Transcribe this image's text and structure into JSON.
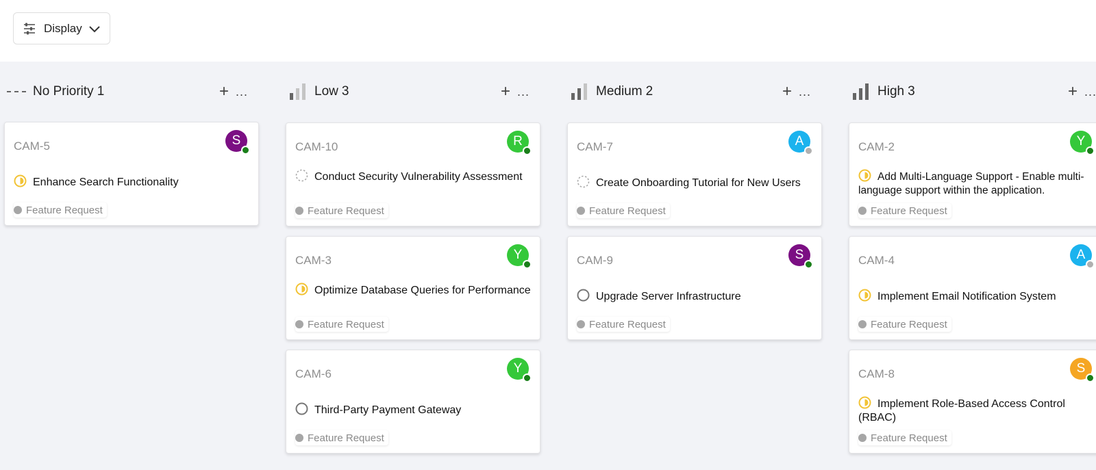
{
  "toolbar": {
    "display_label": "Display",
    "display_icon": "sliders-icon",
    "chevron_icon": "chevron-down-icon"
  },
  "colors": {
    "board_bg": "#f2f3f7",
    "in_progress": "#f2c335",
    "online": "#1a7f1a",
    "offline": "#b0b0b0"
  },
  "columns": [
    {
      "title": "No Priority",
      "count": "1",
      "icon": "no-priority-icon",
      "add": "+",
      "more": "...",
      "cards": [
        {
          "id": "CAM-5",
          "title": "Enhance Search Functionality",
          "status": "in-progress",
          "avatar": "S",
          "avatar_color": "#7b0f83",
          "presence": "online",
          "tag": "Feature Request"
        }
      ]
    },
    {
      "title": "Low",
      "count": "3",
      "icon": "low-priority-icon",
      "add": "+",
      "more": "...",
      "cards": [
        {
          "id": "CAM-10",
          "title": "Conduct Security Vulnerability Assessment",
          "status": "backlog",
          "avatar": "R",
          "avatar_color": "#35c83a",
          "presence": "online",
          "tag": "Feature Request"
        },
        {
          "id": "CAM-3",
          "title": "Optimize Database Queries for Performance",
          "status": "in-progress",
          "avatar": "Y",
          "avatar_color": "#35c83a",
          "presence": "online",
          "tag": "Feature Request"
        },
        {
          "id": "CAM-6",
          "title": "Third-Party Payment Gateway",
          "status": "todo",
          "avatar": "Y",
          "avatar_color": "#35c83a",
          "presence": "online",
          "tag": "Feature Request"
        }
      ]
    },
    {
      "title": "Medium",
      "count": "2",
      "icon": "medium-priority-icon",
      "add": "+",
      "more": "...",
      "cards": [
        {
          "id": "CAM-7",
          "title": "Create Onboarding Tutorial for New Users",
          "status": "backlog",
          "avatar": "A",
          "avatar_color": "#1bb3ee",
          "presence": "offline",
          "tag": "Feature Request"
        },
        {
          "id": "CAM-9",
          "title": "Upgrade Server Infrastructure",
          "status": "todo",
          "avatar": "S",
          "avatar_color": "#7b0f83",
          "presence": "online",
          "tag": "Feature Request"
        }
      ]
    },
    {
      "title": "High",
      "count": "3",
      "icon": "high-priority-icon",
      "add": "+",
      "more": "...",
      "cards": [
        {
          "id": "CAM-2",
          "title": "Add Multi-Language Support - Enable multi-language support within the application.",
          "status": "in-progress",
          "avatar": "Y",
          "avatar_color": "#35c83a",
          "presence": "online",
          "tag": "Feature Request"
        },
        {
          "id": "CAM-4",
          "title": "Implement Email Notification System",
          "status": "in-progress",
          "avatar": "A",
          "avatar_color": "#1bb3ee",
          "presence": "offline",
          "tag": "Feature Request"
        },
        {
          "id": "CAM-8",
          "title": "Implement Role-Based Access Control (RBAC)",
          "status": "in-progress",
          "avatar": "S",
          "avatar_color": "#f5a623",
          "presence": "online",
          "tag": "Feature Request"
        }
      ]
    }
  ]
}
